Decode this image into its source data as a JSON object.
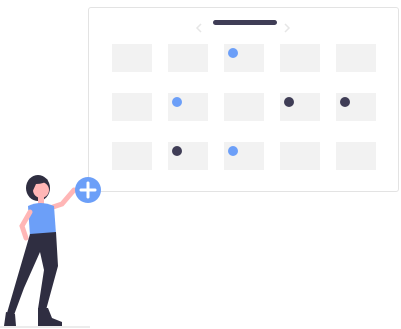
{
  "colors": {
    "accent": "#6c9ff8",
    "dark": "#3f3d56",
    "cell": "#f2f2f2",
    "border": "#e3e3e3",
    "arrow": "#e6e6e6"
  },
  "icons": {
    "prev": "chevron-left-icon",
    "next": "chevron-right-icon",
    "add": "plus-icon"
  },
  "calendar": {
    "rows": 3,
    "columns": 5,
    "events": [
      {
        "row": 0,
        "col": 2,
        "color": "accent"
      },
      {
        "row": 1,
        "col": 1,
        "color": "accent"
      },
      {
        "row": 1,
        "col": 3,
        "color": "dark"
      },
      {
        "row": 1,
        "col": 4,
        "color": "dark"
      },
      {
        "row": 2,
        "col": 1,
        "color": "dark"
      },
      {
        "row": 2,
        "col": 2,
        "color": "accent"
      }
    ]
  }
}
